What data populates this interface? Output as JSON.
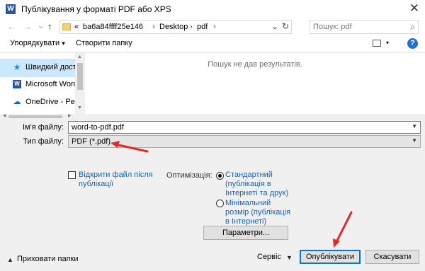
{
  "window": {
    "title": "Публікування у форматі PDF або XPS",
    "app_icon": "word-icon",
    "close_glyph": "✕"
  },
  "nav": {
    "back_glyph": "←",
    "forward_glyph": "→",
    "recent_glyph": "⌄",
    "up_glyph": "↑",
    "address": {
      "overflow": "«",
      "segments": [
        "ba6a84ffff25e146",
        "Desktop",
        "pdf"
      ],
      "separator": "›",
      "dropdown_glyph": "⌄",
      "refresh_glyph": "↻"
    },
    "search": {
      "placeholder": "Пошук: pdf",
      "icon": "search-icon"
    }
  },
  "toolbar": {
    "organize_label": "Упорядкувати",
    "organize_caret": "▾",
    "new_folder_label": "Створити папку",
    "view_caret": "▾",
    "help_glyph": "?"
  },
  "sidebar": {
    "items": [
      {
        "label": "Швидкий доступ",
        "icon": "star-icon",
        "glyph": "★",
        "selected": true
      },
      {
        "label": "Microsoft Word",
        "icon": "word-icon",
        "glyph": "W",
        "selected": false
      },
      {
        "label": "OneDrive - Persor",
        "icon": "cloud-icon",
        "glyph": "☁",
        "selected": false
      }
    ]
  },
  "filelist": {
    "empty_message": "Пошук не дав результатів."
  },
  "form": {
    "filename_label": "Ім'я файлу:",
    "filename_value": "word-to-pdf.pdf",
    "filetype_label": "Тип файлу:",
    "filetype_value": "PDF (*.pdf)",
    "open_after_label": "Відкрити файл після публікації",
    "open_after_checked": false,
    "optimize_label": "Оптимізація:",
    "options": [
      {
        "label": "Стандартний (публікація в Інтернеті та друк)",
        "selected": true
      },
      {
        "label": "Мінімальний розмір (публікація в Інтернеті)",
        "selected": false
      }
    ],
    "params_label": "Параметри..."
  },
  "footer": {
    "hide_folders_label": "Приховати папки",
    "hide_caret": "▲",
    "service_label": "Сервіс",
    "service_caret": "▼",
    "publish_label": "Опублікувати",
    "cancel_label": "Скасувати"
  },
  "colors": {
    "accent": "#0078d7",
    "link": "#1a5fb4",
    "annotation_arrow": "#e02a2a",
    "selected_bg": "#cce8ff"
  }
}
